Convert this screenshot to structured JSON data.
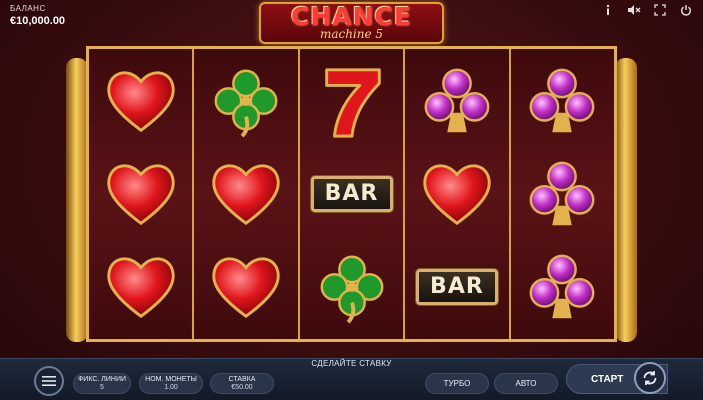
{
  "balance": {
    "label": "БАЛАНС",
    "value": "€10,000.00"
  },
  "logo": {
    "title": "CHANCE",
    "subtitle": "machine 5"
  },
  "top_icons": [
    "info-icon",
    "sound-muted-icon",
    "fullscreen-icon",
    "power-icon"
  ],
  "reels": [
    [
      "heart",
      "heart",
      "heart"
    ],
    [
      "clover",
      "heart",
      "heart"
    ],
    [
      "seven",
      "bar",
      "clover"
    ],
    [
      "club",
      "heart",
      "bar"
    ],
    [
      "club",
      "club",
      "club"
    ]
  ],
  "bar_text": "BAR",
  "bottom": {
    "prompt": "СДЕЛАЙТЕ СТАВКУ",
    "lines_label": "ФИКС. ЛИНИИ",
    "lines_value": "5",
    "coin_label": "НОМ. МОНЕТЫ",
    "coin_value": "1.00",
    "stake_label": "СТАВКА",
    "stake_value": "€50.00",
    "turbo_label": "ТУРБО",
    "auto_label": "АВТО",
    "start_label": "СТАРТ"
  },
  "colors": {
    "heart": "#e0161c",
    "clover": "#1f9a2a",
    "club": "#c02ec6",
    "gold": "#e4b24c"
  }
}
